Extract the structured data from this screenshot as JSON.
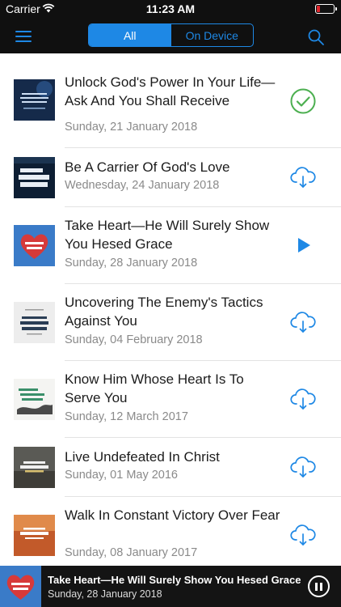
{
  "status": {
    "carrier": "Carrier",
    "time": "11:23 AM",
    "battery_level": 0.2
  },
  "nav": {
    "segments": [
      {
        "label": "All",
        "active": true
      },
      {
        "label": "On Device",
        "active": false
      }
    ]
  },
  "colors": {
    "accent": "#1e88e5",
    "downloaded": "#4caf50",
    "nav_bg": "#101010",
    "player_bg": "#141414"
  },
  "sermons": [
    {
      "title": "Unlock God's Power In Your Life—Ask And You Shall Receive",
      "date": "Sunday, 21 January 2018",
      "status": "downloaded",
      "icon": "checkmark-circle-icon"
    },
    {
      "title": "Be A Carrier Of God's Love",
      "date": "Wednesday, 24 January 2018",
      "status": "download",
      "icon": "cloud-download-icon"
    },
    {
      "title": "Take Heart—He Will Surely Show You Hesed Grace",
      "date": "Sunday, 28 January 2018",
      "status": "playing",
      "icon": "play-icon"
    },
    {
      "title": "Uncovering The Enemy's Tactics Against You",
      "date": "Sunday, 04 February 2018",
      "status": "download",
      "icon": "cloud-download-icon"
    },
    {
      "title": "Know Him Whose Heart Is To Serve You",
      "date": "Sunday, 12 March 2017",
      "status": "download",
      "icon": "cloud-download-icon"
    },
    {
      "title": "Live Undefeated In Christ",
      "date": "Sunday, 01 May 2016",
      "status": "download",
      "icon": "cloud-download-icon"
    },
    {
      "title": "Walk In Constant Victory Over Fear",
      "date": "Sunday, 08 January 2017",
      "status": "download",
      "icon": "cloud-download-icon"
    }
  ],
  "player": {
    "title": "Take Heart—He Will Surely Show You Hesed Grace",
    "date": "Sunday, 28 January 2018",
    "icon": "pause-icon"
  }
}
